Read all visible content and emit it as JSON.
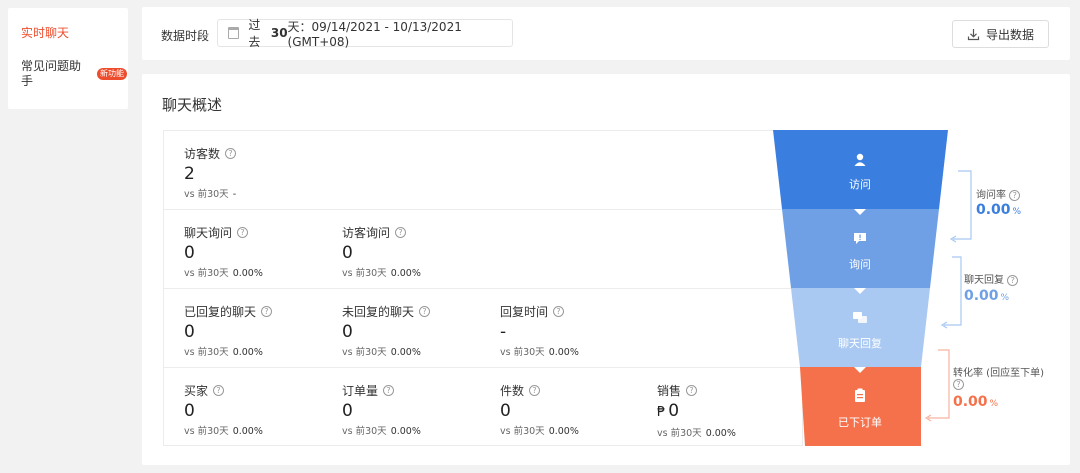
{
  "sidebar": {
    "items": [
      {
        "label": "实时聊天",
        "active": true
      },
      {
        "label": "常见问题助手",
        "badge": "新功能"
      }
    ]
  },
  "header": {
    "period_label": "数据时段",
    "date_prefix": "过去",
    "date_days": "30",
    "date_suffix": "天：09/14/2021 - 10/13/2021 (GMT+08)",
    "export_label": "导出数据"
  },
  "overview": {
    "title": "聊天概述",
    "help_glyph": "?",
    "compare_prefix": "vs 前30天",
    "rows": [
      [
        {
          "label": "访客数",
          "value": "2",
          "change": "-"
        }
      ],
      [
        {
          "label": "聊天询问",
          "value": "0",
          "change": "0.00%"
        },
        {
          "label": "访客询问",
          "value": "0",
          "change": "0.00%"
        }
      ],
      [
        {
          "label": "已回复的聊天",
          "value": "0",
          "change": "0.00%"
        },
        {
          "label": "未回复的聊天",
          "value": "0",
          "change": "0.00%"
        },
        {
          "label": "回复时间",
          "value": "-",
          "change": "0.00%"
        }
      ],
      [
        {
          "label": "买家",
          "value": "0",
          "change": "0.00%"
        },
        {
          "label": "订单量",
          "value": "0",
          "change": "0.00%"
        },
        {
          "label": "件数",
          "value": "0",
          "change": "0.00%"
        },
        {
          "label": "销售",
          "value": "0",
          "currency": "₱",
          "change": "0.00%"
        }
      ]
    ]
  },
  "funnel": {
    "stages": [
      {
        "label": "访问",
        "icon": "user-icon",
        "color": "#3a7fdf"
      },
      {
        "label": "询问",
        "icon": "chat-alert-icon",
        "color": "#6fa0e6"
      },
      {
        "label": "聊天回复",
        "icon": "chat-reply-icon",
        "color": "#a9c8f2"
      },
      {
        "label": "已下订单",
        "icon": "clipboard-icon",
        "color": "#f5714b"
      }
    ],
    "rates": [
      {
        "label": "询问率",
        "value": "0.00",
        "unit": "%",
        "color": "#3a7fdf"
      },
      {
        "label": "聊天回复",
        "value": "0.00",
        "unit": "%",
        "color": "#6fa0e6"
      },
      {
        "label": "转化率 (回应至下单)",
        "value": "0.00",
        "unit": "%",
        "color": "#f5714b"
      }
    ]
  }
}
